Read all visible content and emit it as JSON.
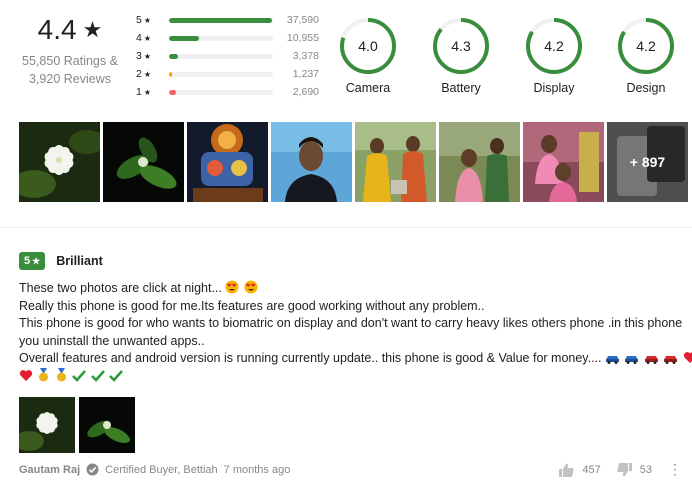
{
  "summary": {
    "average": "4.4",
    "ratings_text": "55,850 Ratings &",
    "reviews_text": "3,920 Reviews",
    "distribution": [
      {
        "label": "5",
        "count": "37,590",
        "fraction": 0.99,
        "color": "#388e3c"
      },
      {
        "label": "4",
        "count": "10,955",
        "fraction": 0.29,
        "color": "#388e3c"
      },
      {
        "label": "3",
        "count": "3,378",
        "fraction": 0.09,
        "color": "#388e3c"
      },
      {
        "label": "2",
        "count": "1,237",
        "fraction": 0.03,
        "color": "#ff9f00"
      },
      {
        "label": "1",
        "count": "2,690",
        "fraction": 0.07,
        "color": "#ff6161"
      }
    ],
    "features": [
      {
        "name": "Camera",
        "value": "4.0",
        "fraction": 0.8
      },
      {
        "name": "Battery",
        "value": "4.3",
        "fraction": 0.86
      },
      {
        "name": "Display",
        "value": "4.2",
        "fraction": 0.84
      },
      {
        "name": "Design",
        "value": "4.2",
        "fraction": 0.84
      }
    ]
  },
  "photos": {
    "more_label": "+ 897"
  },
  "review": {
    "rating": "5",
    "title": "Brilliant",
    "lines": [
      "These two photos are click at night...",
      "Really this phone is good for me.Its features are good working without any problem..",
      "This phone is good for who wants to biomatric on display and don't want to carry heavy likes others phone .in this phone",
      "you uninstall the unwanted apps..",
      "Overall features and android version is running currently update.. this phone is good & Value for money...."
    ],
    "author": "Gautam Raj",
    "certified": "Certified Buyer, Bettiah",
    "time": "7 months ago",
    "likes": "457",
    "dislikes": "53"
  },
  "colors": {
    "green": "#388e3c",
    "orange": "#ff9f00",
    "red": "#ff6161",
    "grey_text": "#878787"
  }
}
